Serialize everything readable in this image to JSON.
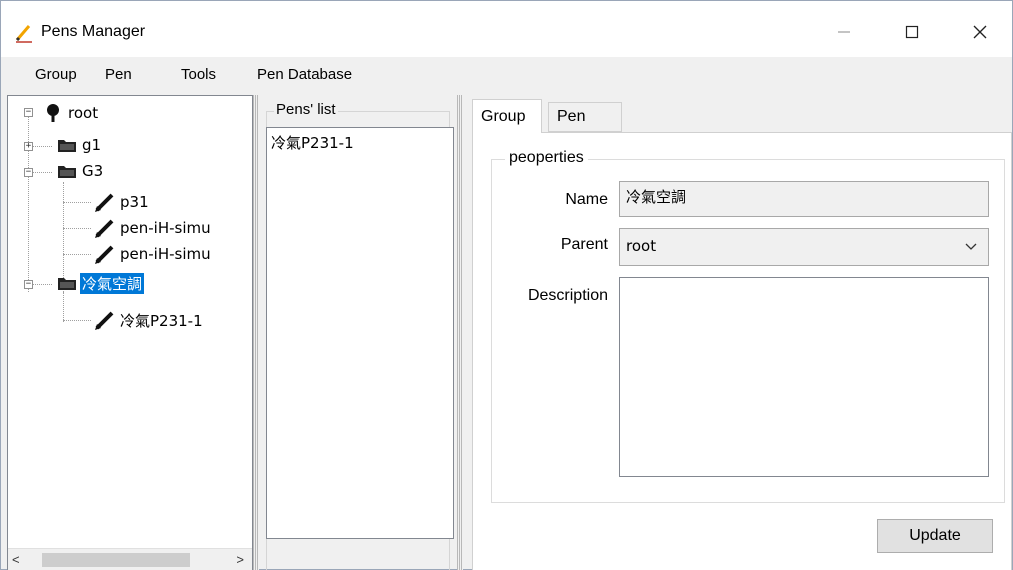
{
  "window": {
    "title": "Pens Manager"
  },
  "menu": {
    "items": [
      "Group",
      "Pen",
      "Tools",
      "Pen Database"
    ]
  },
  "tree": {
    "root": "root",
    "nodes": [
      {
        "label": "g1",
        "type": "folder",
        "expanded": false
      },
      {
        "label": "G3",
        "type": "folder",
        "expanded": true
      },
      {
        "label": "p31",
        "type": "pen"
      },
      {
        "label": "pen-iH-simu",
        "type": "pen"
      },
      {
        "label": "pen-iH-simu",
        "type": "pen"
      },
      {
        "label": "冷氣空調",
        "type": "folder",
        "expanded": true,
        "selected": true
      },
      {
        "label": "冷氣P231-1",
        "type": "pen"
      }
    ]
  },
  "pens_list": {
    "title": "Pens' list",
    "items": [
      "冷氣P231-1"
    ]
  },
  "tabs": [
    {
      "label": "Group",
      "active": true
    },
    {
      "label": "Pen",
      "active": false
    }
  ],
  "properties": {
    "legend": "peoperties",
    "name_label": "Name",
    "name_value": "冷氣空調",
    "parent_label": "Parent",
    "parent_value": "root",
    "description_label": "Description",
    "description_value": ""
  },
  "buttons": {
    "update": "Update"
  },
  "colors": {
    "selection": "#0078d7",
    "window_bg": "#f0f0f0"
  },
  "icons": {
    "app": "pencil-icon",
    "root": "tree-icon",
    "folder": "folder-icon",
    "pen": "pen-icon"
  }
}
